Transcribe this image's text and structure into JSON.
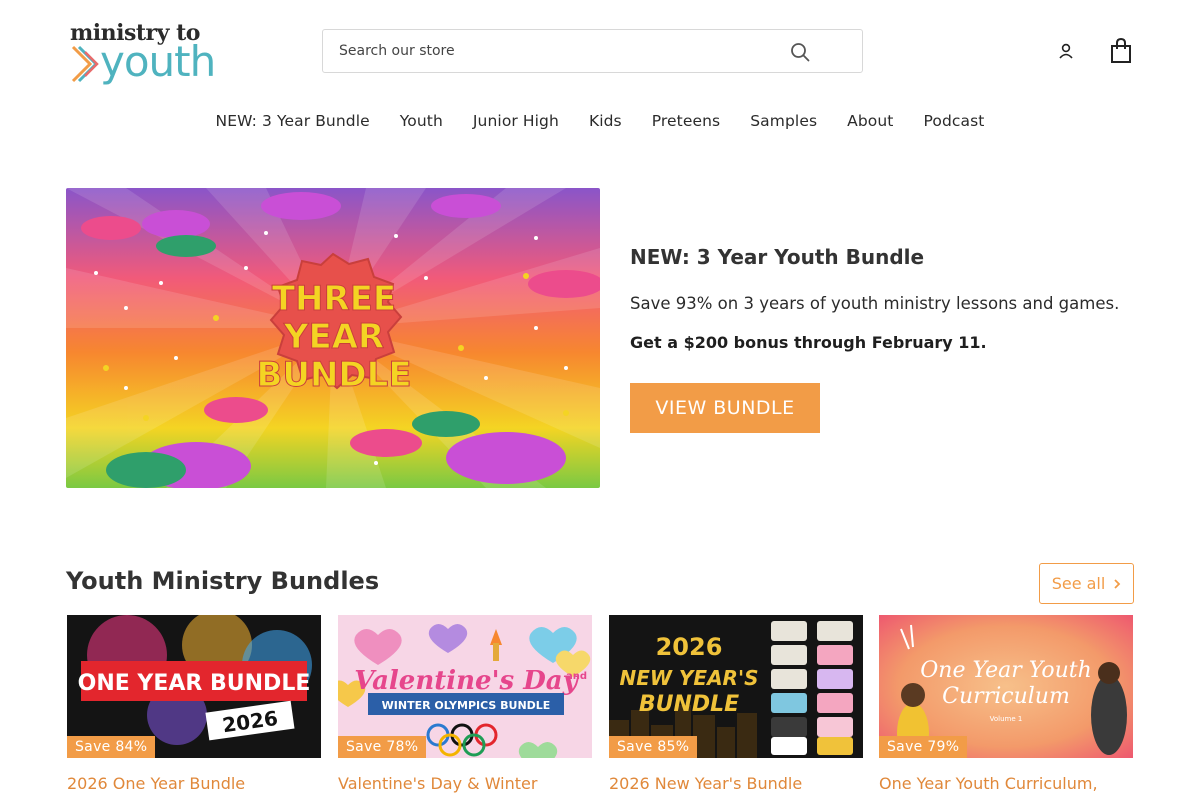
{
  "header": {
    "logo_line1": "ministry to",
    "logo_line2": "youth",
    "search_placeholder": "Search our store",
    "icons": [
      "search-icon",
      "account-icon",
      "cart-icon"
    ]
  },
  "nav": {
    "items": [
      "NEW: 3 Year Bundle",
      "Youth",
      "Junior High",
      "Kids",
      "Preteens",
      "Samples",
      "About",
      "Podcast"
    ]
  },
  "hero": {
    "image_text": [
      "THREE",
      "YEAR",
      "BUNDLE"
    ],
    "title": "NEW: 3 Year Youth Bundle",
    "subtitle": "Save 93% on 3 years of youth ministry lessons and games.",
    "bonus": "Get a $200 bonus through February 11.",
    "button": "VIEW BUNDLE"
  },
  "bundles": {
    "title": "Youth Ministry Bundles",
    "see_all": "See all",
    "cards": [
      {
        "badge": "Save 84%",
        "title": "2026 One Year Bundle",
        "image_text": [
          "ONE YEAR BUNDLE",
          "2026"
        ]
      },
      {
        "badge": "Save 78%",
        "title": "Valentine's Day & Winter",
        "image_text": [
          "Valentine's Day",
          "and",
          "WINTER OLYMPICS BUNDLE"
        ]
      },
      {
        "badge": "Save 85%",
        "title": "2026 New Year's Bundle",
        "image_text": [
          "2026",
          "NEW YEAR'S",
          "BUNDLE"
        ]
      },
      {
        "badge": "Save 79%",
        "title": "One Year Youth Curriculum,",
        "image_text": [
          "One Year Youth",
          "Curriculum",
          "Volume 1"
        ]
      }
    ]
  },
  "colors": {
    "accent": "#f29c47",
    "link": "#e0883a",
    "logo_teal": "#4fb3bf"
  }
}
